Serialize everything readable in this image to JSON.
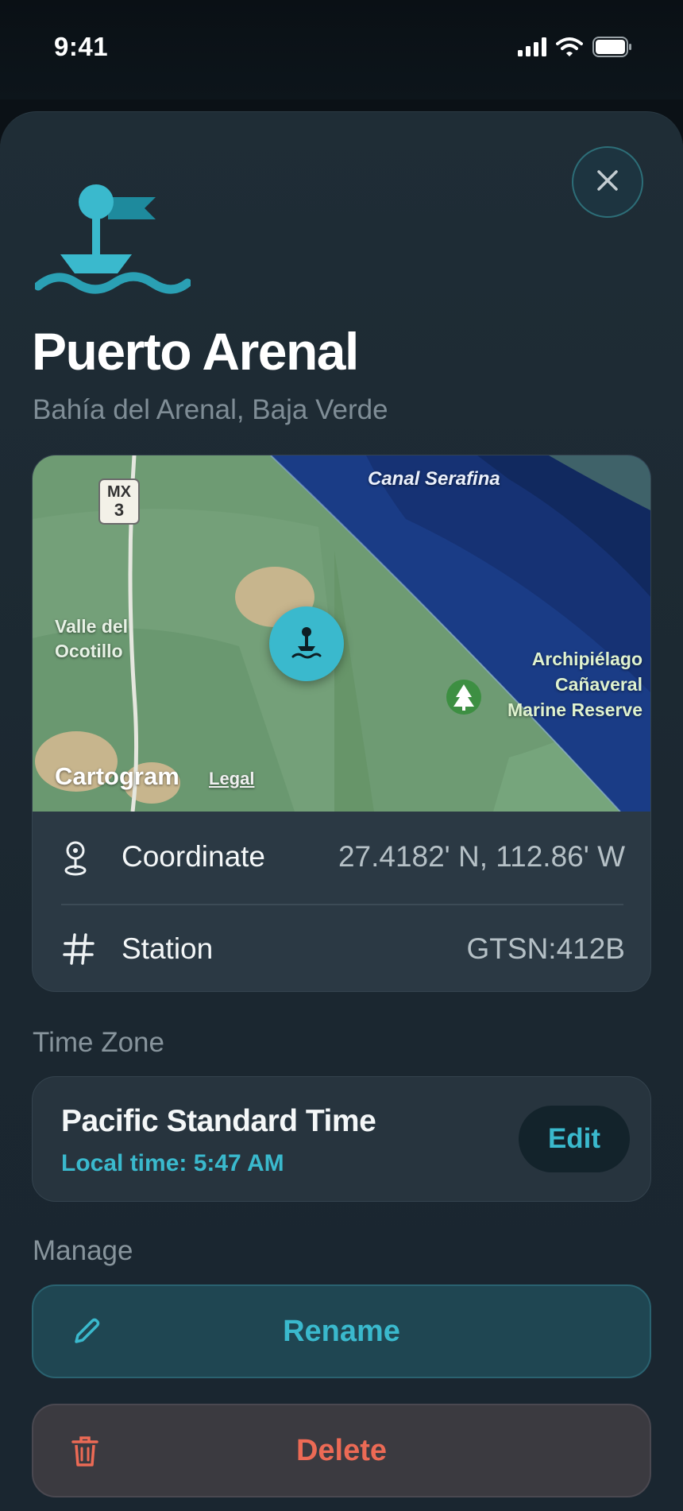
{
  "status_bar": {
    "time": "9:41"
  },
  "header": {
    "title": "Puerto Arenal",
    "subtitle": "Bahía del Arenal, Baja Verde"
  },
  "map": {
    "shield_line1": "MX",
    "shield_line2": "3",
    "label_channel": "Canal Serafina",
    "label_valley_line1": "Valle del",
    "label_valley_line2": "Ocotillo",
    "label_reserve_line1": "Archipiélago",
    "label_reserve_line2": "Cañaveral",
    "label_reserve_line3": "Marine Reserve",
    "attribution": "Cartogram",
    "legal": "Legal"
  },
  "details": {
    "coordinate_label": "Coordinate",
    "coordinate_value": "27.4182' N, 112.86' W",
    "station_label": "Station",
    "station_value": "GTSN:412B"
  },
  "time_zone": {
    "section_label": "Time Zone",
    "name": "Pacific Standard Time",
    "local_time": "Local time: 5:47 AM",
    "edit_label": "Edit"
  },
  "manage": {
    "section_label": "Manage",
    "rename_label": "Rename",
    "delete_label": "Delete"
  },
  "colors": {
    "accent": "#3ab9cd",
    "destructive": "#ec6a55",
    "sheet_background": "#1f2d36",
    "card_background": "#2b3944"
  }
}
